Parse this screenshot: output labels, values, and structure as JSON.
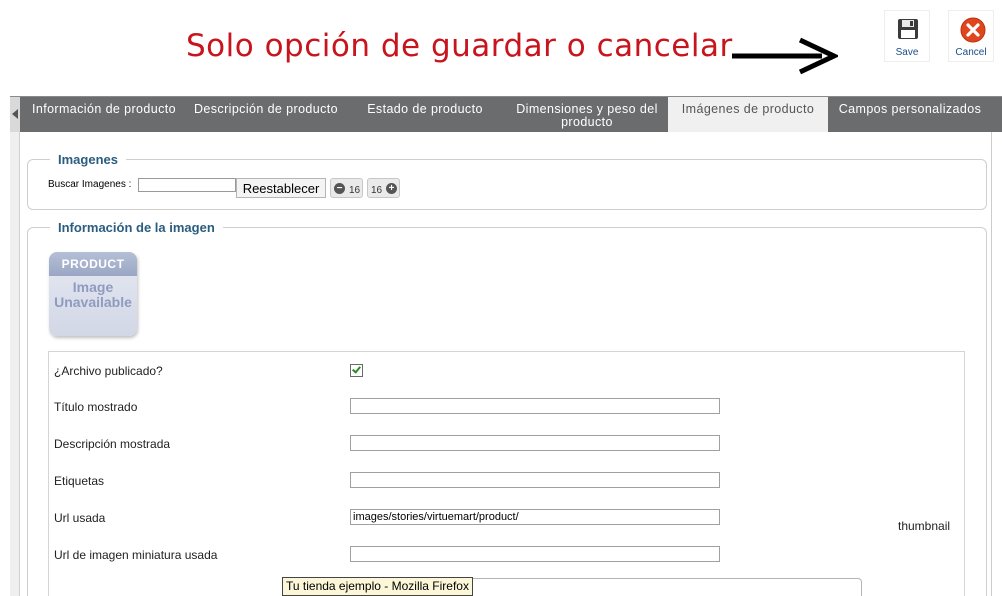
{
  "annotation": {
    "text": "Solo opción de guardar o cancelar"
  },
  "toolbar": {
    "save_label": "Save",
    "cancel_label": "Cancel"
  },
  "tabs": [
    {
      "label": "Información de producto"
    },
    {
      "label": "Descripción de producto"
    },
    {
      "label": "Estado de producto"
    },
    {
      "label_line1": "Dimensiones y peso del",
      "label_line2": "producto"
    },
    {
      "label": "Imágenes de producto"
    },
    {
      "label": "Campos personalizados"
    }
  ],
  "images_section": {
    "legend": "Imagenes",
    "search_label": "Buscar Imagenes :",
    "search_value": "",
    "reset_label": "Reestablecer",
    "pager_prev_count": "16",
    "pager_next_count": "16"
  },
  "image_info": {
    "legend": "Información de la imagen",
    "placeholder_banner": "PRODUCT",
    "placeholder_line1": "Image",
    "placeholder_line2": "Unavailable"
  },
  "form": {
    "published_label": "¿Archivo publicado?",
    "published_checked": true,
    "title_label": "Título mostrado",
    "title_value": "",
    "description_label": "Descripción mostrada",
    "description_value": "",
    "tags_label": "Etiquetas",
    "tags_value": "",
    "url_label": "Url usada",
    "url_value": "images/stories/virtuemart/product/",
    "thumb_url_label": "Url de imagen miniatura usada",
    "thumb_url_value": "",
    "thumbnail_text": "thumbnail"
  },
  "tooltip": {
    "text": "Tu tienda ejemplo - Mozilla Firefox"
  },
  "colors": {
    "annotation_red": "#c8141c",
    "tab_bar": "#6b6c6e",
    "legend_blue": "#2a5d80",
    "cancel_red": "#e0461d"
  },
  "icons": {
    "save": "floppy-disk-icon",
    "cancel": "cancel-x-icon",
    "minus": "minus-circle-icon",
    "plus": "plus-circle-icon"
  }
}
